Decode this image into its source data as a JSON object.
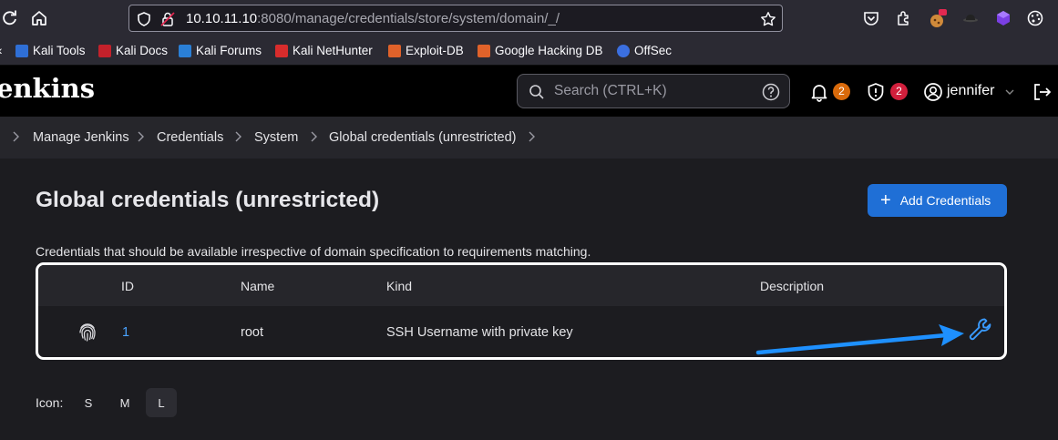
{
  "browser": {
    "url_host": "10.10.11.10",
    "url_rest": ":8080/manage/credentials/store/system/domain/_/",
    "bookmarks": [
      "Kali Tools",
      "Kali Docs",
      "Kali Forums",
      "Kali NetHunter",
      "Exploit-DB",
      "Google Hacking DB",
      "OffSec"
    ]
  },
  "header": {
    "brand": "enkins",
    "search_placeholder": "Search (CTRL+K)",
    "notifications_count": "2",
    "security_count": "2",
    "username": "jennifer"
  },
  "breadcrumb": [
    "Manage Jenkins",
    "Credentials",
    "System",
    "Global credentials (unrestricted)"
  ],
  "page": {
    "title": "Global credentials (unrestricted)",
    "add_button": "Add Credentials",
    "description": "Credentials that should be available irrespective of domain specification to requirements matching."
  },
  "table": {
    "headers": [
      "ID",
      "Name",
      "Kind",
      "Description"
    ],
    "rows": [
      {
        "id": "1",
        "name": "root",
        "kind": "SSH Username with private key",
        "description": ""
      }
    ]
  },
  "icon_size": {
    "label": "Icon:",
    "options": [
      "S",
      "M",
      "L"
    ],
    "selected": "L"
  },
  "colors": {
    "accent": "#1f6fd6",
    "annotation_arrow": "#1e90ff",
    "notification_badge": "#d96a0b",
    "security_badge": "#d21f3c"
  }
}
